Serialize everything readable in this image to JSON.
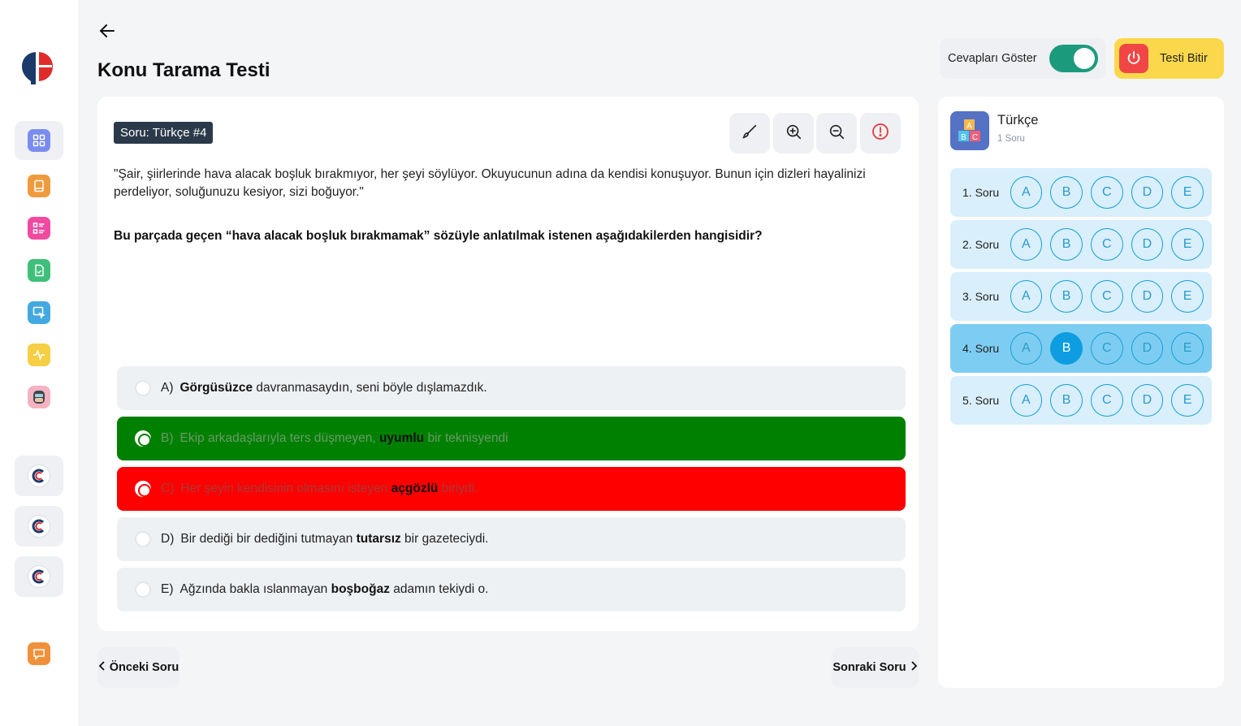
{
  "page": {
    "title": "Konu Tarama Testi"
  },
  "question": {
    "badge": "Soru: Türkçe #4",
    "passage": "\"Şair, şiirlerinde hava alacak boşluk bırakmıyor, her şeyi söylüyor. Okuyucunun adına da kendisi konuşuyor. Bunun için dizleri hayalinizi perdeliyor, soluğunuzu kesiyor, sizi boğuyor.\"",
    "prompt": "Bu parçada geçen “hava alacak boşluk bırakmamak” sözüyle anlatılmak istenen aşağıdakilerden hangisidir?",
    "options": [
      {
        "letter": "A)",
        "bold": "Görgüsüzce",
        "before": "",
        "after": " davranmasaydın, seni böyle dışlamazdık.",
        "state": "normal"
      },
      {
        "letter": "B)",
        "before": "Ekip arkadaşlarıyla ters düşmeyen, ",
        "bold": "uyumlu",
        "after": " bir teknisyendi",
        "state": "correct"
      },
      {
        "letter": "C)",
        "before": "Her şeyin kendisinin olmasını isteyen ",
        "bold": "açgözlü",
        "after": " biriydi.",
        "state": "wrong"
      },
      {
        "letter": "D)",
        "before": "Bir dediği bir dediğini tutmayan ",
        "bold": "tutarsız",
        "after": " bir gazeteciydi.",
        "state": "normal"
      },
      {
        "letter": "E)",
        "before": "Ağzında bakla ıslanmayan ",
        "bold": "boşboğaz",
        "after": " adamın tekiydi o.",
        "state": "normal"
      }
    ]
  },
  "nav": {
    "prev": "Önceki Soru",
    "next": "Sonraki Soru"
  },
  "controls": {
    "show_answers_label": "Cevapları Göster",
    "show_answers_on": true,
    "finish_label": "Testi Bitir"
  },
  "answer_sheet": {
    "subject": "Türkçe",
    "count": "1 Soru",
    "choices": [
      "A",
      "B",
      "C",
      "D",
      "E"
    ],
    "rows": [
      {
        "label": "1. Soru",
        "selected": null,
        "active": false
      },
      {
        "label": "2. Soru",
        "selected": null,
        "active": false
      },
      {
        "label": "3. Soru",
        "selected": null,
        "active": false
      },
      {
        "label": "4. Soru",
        "selected": "B",
        "active": true
      },
      {
        "label": "5. Soru",
        "selected": null,
        "active": false
      }
    ]
  },
  "colors": {
    "correct": "#008000",
    "wrong": "#ff0000",
    "accent": "#0d9de0",
    "toggle": "#1c9b7c",
    "finish": "#fbd84b"
  },
  "sidebar_icons": [
    "dashboard-icon",
    "book-icon",
    "list-icon",
    "document-check-icon",
    "cursor-select-icon",
    "activity-icon",
    "avatar",
    "publisher-logo",
    "publisher-logo",
    "publisher-logo",
    "chat-icon"
  ]
}
